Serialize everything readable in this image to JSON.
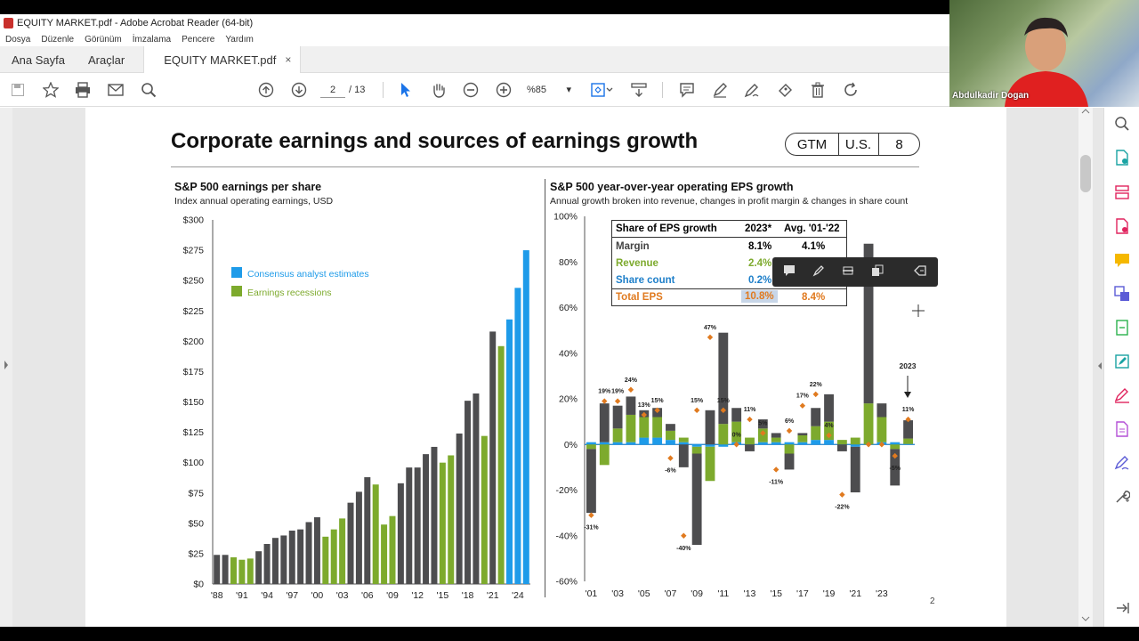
{
  "window": {
    "title": "EQUITY MARKET.pdf - Adobe Acrobat Reader (64-bit)"
  },
  "menu": [
    "Dosya",
    "Düzenle",
    "Görünüm",
    "İmzalama",
    "Pencere",
    "Yardım"
  ],
  "tabs": {
    "home": "Ana Sayfa",
    "tools": "Araçlar",
    "doc": "EQUITY MARKET.pdf",
    "close": "×"
  },
  "toolbar": {
    "page_current": "2",
    "page_total": "/ 13",
    "zoom": "%85",
    "zoom_caret": "▾"
  },
  "webcam": {
    "name": "Abdulkadir Dogan"
  },
  "doc": {
    "title": "Corporate earnings and sources of earnings growth",
    "badges": [
      "GTM",
      "U.S.",
      "8"
    ],
    "page_number": "2"
  },
  "left_chart": {
    "title": "S&P 500 earnings per share",
    "subtitle": "Index annual operating earnings, USD",
    "legend": [
      {
        "label": "Consensus analyst estimates",
        "color": "#1e9be9"
      },
      {
        "label": "Earnings recessions",
        "color": "#7daa2d"
      }
    ]
  },
  "right_chart": {
    "title": "S&P 500 year-over-year operating EPS growth",
    "subtitle": "Annual growth broken into revenue, changes in profit margin & changes in share count",
    "marker_label": "2023",
    "table": {
      "headers": [
        "Share of EPS growth",
        "2023*",
        "Avg. '01-'22"
      ],
      "rows": [
        {
          "label": "Margin",
          "v2023": "8.1%",
          "avg": "4.1%",
          "color": "#444444"
        },
        {
          "label": "Revenue",
          "v2023": "2.4%",
          "avg": "",
          "color": "#7daa2d"
        },
        {
          "label": "Share count",
          "v2023": "0.2%",
          "avg": "",
          "color": "#1e7fc9"
        },
        {
          "label": "Total EPS",
          "v2023": "10.8%",
          "avg": "8.4%",
          "color": "#e07a1f"
        }
      ]
    }
  },
  "chart_data": [
    {
      "type": "bar",
      "title": "S&P 500 earnings per share",
      "ylabel": "Index annual operating earnings, USD",
      "ylim": [
        0,
        300
      ],
      "yticks": [
        "$0",
        "$25",
        "$50",
        "$75",
        "$100",
        "$125",
        "$150",
        "$175",
        "$200",
        "$225",
        "$250",
        "$275",
        "$300"
      ],
      "xticks": [
        "'88",
        "'91",
        "'94",
        "'97",
        "'00",
        "'03",
        "'06",
        "'09",
        "'12",
        "'15",
        "'18",
        "'21",
        "'24"
      ],
      "years": [
        1988,
        1989,
        1990,
        1991,
        1992,
        1993,
        1994,
        1995,
        1996,
        1997,
        1998,
        1999,
        2000,
        2001,
        2002,
        2003,
        2004,
        2005,
        2006,
        2007,
        2008,
        2009,
        2010,
        2011,
        2012,
        2013,
        2014,
        2015,
        2016,
        2017,
        2018,
        2019,
        2020,
        2021,
        2022,
        2023,
        2024,
        2025
      ],
      "values": [
        24,
        24,
        22,
        20,
        21,
        27,
        33,
        38,
        40,
        44,
        45,
        51,
        55,
        39,
        45,
        54,
        67,
        76,
        88,
        82,
        49,
        56,
        83,
        96,
        96,
        107,
        113,
        100,
        106,
        124,
        151,
        157,
        122,
        208,
        196,
        218,
        244,
        275
      ],
      "kind": [
        "n",
        "n",
        "r",
        "r",
        "r",
        "n",
        "n",
        "n",
        "n",
        "n",
        "n",
        "n",
        "n",
        "r",
        "r",
        "r",
        "n",
        "n",
        "n",
        "r",
        "r",
        "r",
        "n",
        "n",
        "n",
        "n",
        "n",
        "r",
        "r",
        "n",
        "n",
        "n",
        "r",
        "n",
        "r",
        "e",
        "e",
        "e"
      ]
    },
    {
      "type": "bar",
      "title": "S&P 500 year-over-year operating EPS growth",
      "ylim": [
        -60,
        100
      ],
      "yticks": [
        "-60%",
        "-40%",
        "-20%",
        "0%",
        "20%",
        "40%",
        "60%",
        "80%",
        "100%"
      ],
      "xticks": [
        "'01",
        "'03",
        "'05",
        "'07",
        "'09",
        "'11",
        "'13",
        "'15",
        "'17",
        "'19",
        "'21",
        "'23"
      ],
      "series": [
        {
          "name": "Margin",
          "values": [
            -28,
            17,
            10,
            8,
            3,
            4,
            3,
            -10,
            -40,
            15,
            40,
            6,
            -3,
            4,
            2,
            -7,
            1,
            8,
            12,
            -3,
            -20,
            70,
            6,
            -16,
            8
          ]
        },
        {
          "name": "Revenue",
          "values": [
            -2,
            -9,
            6,
            12,
            9,
            9,
            4,
            2,
            -3,
            -15,
            9,
            9,
            3,
            6,
            2,
            -4,
            3,
            6,
            8,
            2,
            3,
            18,
            11,
            -2,
            2.4
          ]
        },
        {
          "name": "Share count",
          "values": [
            1,
            1,
            1,
            1,
            3,
            3,
            2,
            1,
            -1,
            -1,
            -1,
            1,
            0,
            1,
            1,
            1,
            1,
            2,
            2,
            0,
            -1,
            0,
            1,
            1,
            0.2
          ]
        }
      ],
      "total_eps": [
        -31,
        19,
        19,
        24,
        13,
        15,
        -6,
        -40,
        15,
        47,
        15,
        0,
        11,
        5,
        -11,
        6,
        17,
        22,
        4,
        -22,
        0,
        0,
        -5,
        11
      ],
      "data_labels": [
        "-31%",
        "19%",
        "19%",
        "24%",
        "13%",
        "15%",
        "-6%",
        "-40%",
        "15%",
        "47%",
        "15%",
        "0%",
        "11%",
        "5%",
        "-11%",
        "6%",
        "17%",
        "22%",
        "4%",
        "-22%",
        "-5%",
        "11%"
      ]
    }
  ]
}
